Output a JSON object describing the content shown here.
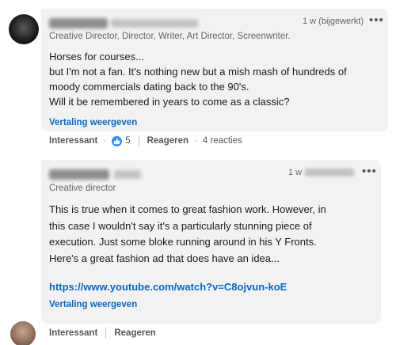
{
  "comment1": {
    "timestamp": "1 w (bijgewerkt)",
    "more_label": "•••",
    "headline": "Creative Director, Director, Writer, Art Director, Screenwriter.",
    "body_lines": [
      "Horses for courses...",
      "but I'm not a fan. It's nothing new but a mish mash of hundreds of",
      "moody commercials dating back to the 90's.",
      "Will it be remembered in years to come as a classic?"
    ],
    "translate_label": "Vertaling weergeven",
    "actions": {
      "like_label": "Interessant",
      "separator_dot": "·",
      "reaction_count": "5",
      "reply_label": "Reageren",
      "replies_dot": "·",
      "replies_count": "4 reacties"
    }
  },
  "comment2": {
    "timestamp": "1 w",
    "more_label": "•••",
    "headline": "Creative director",
    "body_lines": [
      "This is true when it comes to great fashion work. However, in",
      "this case I wouldn't say it's a particularly stunning piece of",
      "execution. Just some bloke running around in his Y Fronts.",
      "Here's a great fashion ad that does have an idea..."
    ],
    "link": "https://www.youtube.com/watch?v=C8ojvun-koE",
    "translate_label": "Vertaling weergeven",
    "actions": {
      "like_label": "Interessant",
      "reply_label": "Reageren"
    }
  },
  "colors": {
    "bubble": "#f2f2f2",
    "link": "#0a66c2",
    "like_icon": "#378fe9"
  }
}
